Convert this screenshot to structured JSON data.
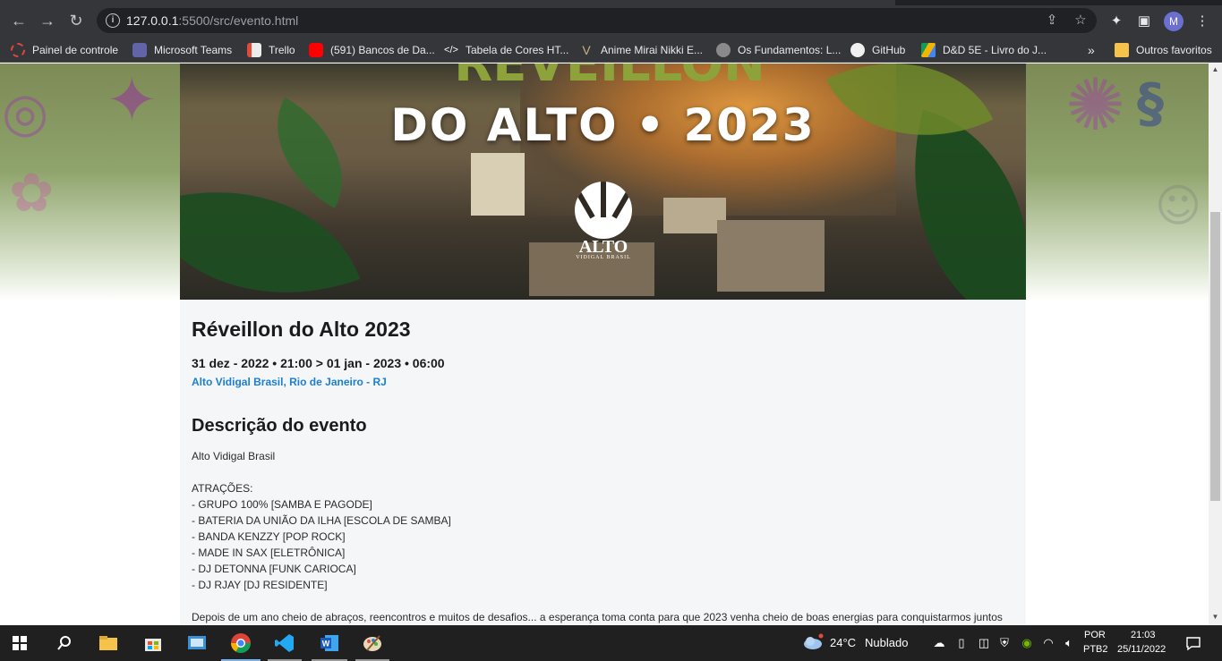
{
  "browser": {
    "url_host": "127.0.0.1",
    "url_rest": ":5500/src/evento.html",
    "profile_initial": "M",
    "bookmarks": [
      {
        "label": "Painel de controle",
        "icon": "redhat-ring-icon"
      },
      {
        "label": "Microsoft Teams",
        "icon": "teams-icon"
      },
      {
        "label": "Trello",
        "icon": "trello-icon"
      },
      {
        "label": "(591) Bancos de Da...",
        "icon": "youtube-icon"
      },
      {
        "label": "Tabela de Cores HT...",
        "icon": "code-icon"
      },
      {
        "label": "Anime Mirai Nikki E...",
        "icon": "anime-icon"
      },
      {
        "label": "Os Fundamentos: L...",
        "icon": "globe-icon"
      },
      {
        "label": "GitHub",
        "icon": "github-icon"
      },
      {
        "label": "D&D 5E - Livro do J...",
        "icon": "drive-icon"
      }
    ],
    "overflow": "»",
    "other_favorites": "Outros favoritos"
  },
  "banner": {
    "top_text": "REVEILLON",
    "title": "DO ALTO • 2023",
    "logo_word": "ALTO",
    "logo_sub": "VIDIGAL BRASIL"
  },
  "event": {
    "title": "Réveillon do Alto 2023",
    "datetime": "31 dez - 2022 • 21:00 > 01 jan - 2023 • 06:00",
    "location": "Alto Vidigal Brasil, Rio de Janeiro - RJ",
    "description_heading": "Descrição do evento",
    "description_lines": [
      "Alto Vidigal Brasil",
      "",
      "ATRAÇÕES:",
      "- GRUPO 100% [SAMBA E PAGODE]",
      "- BATERIA DA UNIÃO DA ILHA [ESCOLA DE SAMBA]",
      "- BANDA KENZZY [POP ROCK]",
      "- MADE IN SAX [ELETRÔNICA]",
      "- DJ DETONNA [FUNK CARIOCA]",
      "- DJ RJAY [DJ RESIDENTE]",
      "",
      "Depois de um ano cheio de abraços, reencontros e muitos de desafios... a esperança toma conta para que 2023 venha cheio de boas energias para conquistarmos juntos"
    ]
  },
  "taskbar": {
    "weather_temp": "24°C",
    "weather_desc": "Nublado",
    "lang_line1": "POR",
    "lang_line2": "PTB2",
    "time": "21:03",
    "date": "25/11/2022"
  },
  "colors": {
    "link_blue": "#1a7fd1",
    "chrome_dark": "#35363a",
    "taskbar": "#202020"
  }
}
